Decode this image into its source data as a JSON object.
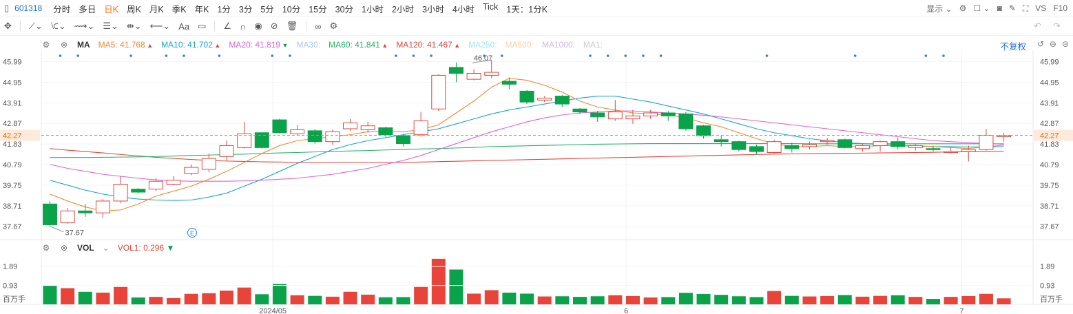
{
  "toolbar_top": {
    "symbol": "601318",
    "timeframes": [
      "分时",
      "多日",
      "日K",
      "周K",
      "月K",
      "季K",
      "年K",
      "1分",
      "3分",
      "5分",
      "10分",
      "15分",
      "30分",
      "1小时",
      "2小时",
      "3小时",
      "4小时",
      "Tick",
      "1天：1分K"
    ],
    "active_timeframe": "日K",
    "display_label": "显示",
    "vs_label": "VS",
    "f10_label": "F10"
  },
  "ma_legend": {
    "name": "MA",
    "items": [
      {
        "label": "MA5:",
        "value": "41.768",
        "color": "#f5872e",
        "arrow": "▲"
      },
      {
        "label": "MA10:",
        "value": "41.702",
        "color": "#1aa3d9",
        "arrow": "▲"
      },
      {
        "label": "MA20:",
        "value": "41.819",
        "color": "#e060e0",
        "arrow": "▼"
      },
      {
        "label": "MA30:",
        "value": "",
        "color": "#a9c7f0",
        "arrow": ""
      },
      {
        "label": "MA60:",
        "value": "41.841",
        "color": "#26b36b",
        "arrow": "▲"
      },
      {
        "label": "MA120:",
        "value": "41.467",
        "color": "#e8443a",
        "arrow": "▲"
      },
      {
        "label": "MA250:",
        "value": "",
        "color": "#9fe6f0",
        "arrow": ""
      },
      {
        "label": "MA500:",
        "value": "",
        "color": "#f6d2a8",
        "arrow": ""
      },
      {
        "label": "MA1000:",
        "value": "",
        "color": "#d3b6ef",
        "arrow": ""
      },
      {
        "label": "MA1:",
        "value": "",
        "color": "#c8c8c8",
        "arrow": ""
      }
    ],
    "adjust_label": "不复权"
  },
  "vol_legend": {
    "name": "VOL",
    "vol1_label": "VOL1:",
    "vol1_value": "0.296",
    "unit_label": "百万手"
  },
  "colors": {
    "up": "#e8443a",
    "down": "#0aa34a",
    "ma5": "#f5872e",
    "ma10": "#1aa3d9",
    "ma20": "#e060e0",
    "ma60": "#26b36b",
    "ma120": "#e8443a",
    "current": "#f5872e",
    "marker": "#2f80ed"
  },
  "chart_data": {
    "type": "candlestick",
    "y_ticks": [
      "45.99",
      "44.95",
      "43.91",
      "42.87",
      "41.83",
      "40.79",
      "39.75",
      "38.71",
      "37.67"
    ],
    "ylim": [
      37.0,
      46.6
    ],
    "current_price": "42.27",
    "high_label": "46.07",
    "low_label": "37.67",
    "x_labels": [
      "2024/05",
      "6",
      "7"
    ],
    "vol_ticks": [
      "1.89",
      "0.93"
    ],
    "vol_ylim": [
      0,
      2.45
    ],
    "candles": [
      {
        "o": 38.8,
        "c": 37.75,
        "h": 38.95,
        "l": 37.67,
        "v": 0.93
      },
      {
        "o": 37.85,
        "c": 38.45,
        "h": 38.6,
        "l": 37.8,
        "v": 0.8
      },
      {
        "o": 38.45,
        "c": 38.35,
        "h": 38.8,
        "l": 38.15,
        "v": 0.62
      },
      {
        "o": 38.35,
        "c": 38.95,
        "h": 39.05,
        "l": 38.1,
        "v": 0.58
      },
      {
        "o": 38.95,
        "c": 39.8,
        "h": 40.2,
        "l": 38.85,
        "v": 0.86
      },
      {
        "o": 39.55,
        "c": 39.4,
        "h": 39.6,
        "l": 39.35,
        "v": 0.34
      },
      {
        "o": 39.55,
        "c": 39.95,
        "h": 40.1,
        "l": 39.45,
        "v": 0.37
      },
      {
        "o": 39.8,
        "c": 40.0,
        "h": 40.2,
        "l": 39.75,
        "v": 0.31
      },
      {
        "o": 40.35,
        "c": 40.65,
        "h": 40.8,
        "l": 40.25,
        "v": 0.52
      },
      {
        "o": 40.55,
        "c": 41.1,
        "h": 41.35,
        "l": 40.4,
        "v": 0.55
      },
      {
        "o": 41.2,
        "c": 41.75,
        "h": 42.0,
        "l": 41.0,
        "v": 0.68
      },
      {
        "o": 41.65,
        "c": 42.35,
        "h": 42.95,
        "l": 41.6,
        "v": 0.83
      },
      {
        "o": 42.4,
        "c": 41.65,
        "h": 42.4,
        "l": 41.6,
        "v": 0.5
      },
      {
        "o": 43.05,
        "c": 42.4,
        "h": 43.1,
        "l": 42.35,
        "v": 1.01
      },
      {
        "o": 42.35,
        "c": 42.55,
        "h": 42.8,
        "l": 42.25,
        "v": 0.45
      },
      {
        "o": 42.5,
        "c": 41.95,
        "h": 42.6,
        "l": 41.85,
        "v": 0.42
      },
      {
        "o": 41.95,
        "c": 42.45,
        "h": 42.55,
        "l": 41.8,
        "v": 0.38
      },
      {
        "o": 42.6,
        "c": 42.9,
        "h": 43.1,
        "l": 42.5,
        "v": 0.62
      },
      {
        "o": 42.55,
        "c": 42.75,
        "h": 42.95,
        "l": 42.4,
        "v": 0.48
      },
      {
        "o": 42.65,
        "c": 42.3,
        "h": 42.7,
        "l": 42.2,
        "v": 0.35
      },
      {
        "o": 42.25,
        "c": 41.85,
        "h": 42.35,
        "l": 41.7,
        "v": 0.36
      },
      {
        "o": 42.3,
        "c": 43.0,
        "h": 43.45,
        "l": 42.2,
        "v": 0.86
      },
      {
        "o": 43.6,
        "c": 45.3,
        "h": 45.35,
        "l": 43.5,
        "v": 2.25
      },
      {
        "o": 45.7,
        "c": 45.4,
        "h": 45.95,
        "l": 44.95,
        "v": 1.72
      },
      {
        "o": 45.1,
        "c": 45.4,
        "h": 45.6,
        "l": 45.05,
        "v": 0.53
      },
      {
        "o": 45.3,
        "c": 45.45,
        "h": 46.07,
        "l": 45.15,
        "v": 0.7
      },
      {
        "o": 45.0,
        "c": 44.85,
        "h": 45.2,
        "l": 44.6,
        "v": 0.58
      },
      {
        "o": 44.5,
        "c": 43.95,
        "h": 44.55,
        "l": 43.85,
        "v": 0.53
      },
      {
        "o": 44.05,
        "c": 44.15,
        "h": 44.25,
        "l": 43.95,
        "v": 0.39
      },
      {
        "o": 44.25,
        "c": 43.85,
        "h": 44.3,
        "l": 43.7,
        "v": 0.4
      },
      {
        "o": 43.6,
        "c": 43.45,
        "h": 43.65,
        "l": 43.35,
        "v": 0.37
      },
      {
        "o": 43.4,
        "c": 43.2,
        "h": 43.5,
        "l": 42.95,
        "v": 0.4
      },
      {
        "o": 43.1,
        "c": 43.45,
        "h": 44.05,
        "l": 43.0,
        "v": 0.45
      },
      {
        "o": 43.1,
        "c": 43.25,
        "h": 43.55,
        "l": 42.85,
        "v": 0.41
      },
      {
        "o": 43.25,
        "c": 43.4,
        "h": 43.55,
        "l": 43.1,
        "v": 0.34
      },
      {
        "o": 43.4,
        "c": 43.25,
        "h": 43.5,
        "l": 43.0,
        "v": 0.36
      },
      {
        "o": 43.35,
        "c": 42.6,
        "h": 43.45,
        "l": 42.5,
        "v": 0.57
      },
      {
        "o": 42.75,
        "c": 42.25,
        "h": 42.8,
        "l": 42.1,
        "v": 0.51
      },
      {
        "o": 42.05,
        "c": 41.95,
        "h": 42.25,
        "l": 41.7,
        "v": 0.47
      },
      {
        "o": 41.95,
        "c": 41.55,
        "h": 42.0,
        "l": 41.45,
        "v": 0.4
      },
      {
        "o": 41.7,
        "c": 41.45,
        "h": 41.8,
        "l": 41.3,
        "v": 0.36
      },
      {
        "o": 41.4,
        "c": 41.95,
        "h": 42.05,
        "l": 41.35,
        "v": 0.66
      },
      {
        "o": 41.75,
        "c": 41.6,
        "h": 41.9,
        "l": 41.4,
        "v": 0.42
      },
      {
        "o": 41.7,
        "c": 41.8,
        "h": 41.95,
        "l": 41.55,
        "v": 0.39
      },
      {
        "o": 41.95,
        "c": 42.0,
        "h": 42.15,
        "l": 41.8,
        "v": 0.41
      },
      {
        "o": 42.05,
        "c": 41.65,
        "h": 42.1,
        "l": 41.6,
        "v": 0.46
      },
      {
        "o": 41.6,
        "c": 41.75,
        "h": 41.85,
        "l": 41.45,
        "v": 0.38
      },
      {
        "o": 41.75,
        "c": 41.95,
        "h": 42.0,
        "l": 41.45,
        "v": 0.42
      },
      {
        "o": 41.95,
        "c": 41.7,
        "h": 42.15,
        "l": 41.55,
        "v": 0.45
      },
      {
        "o": 41.65,
        "c": 41.75,
        "h": 41.85,
        "l": 41.5,
        "v": 0.37
      },
      {
        "o": 41.6,
        "c": 41.55,
        "h": 41.75,
        "l": 41.45,
        "v": 0.27
      },
      {
        "o": 41.4,
        "c": 41.45,
        "h": 41.65,
        "l": 41.35,
        "v": 0.37
      },
      {
        "o": 41.45,
        "c": 41.55,
        "h": 41.75,
        "l": 40.95,
        "v": 0.41
      },
      {
        "o": 41.55,
        "c": 42.27,
        "h": 42.6,
        "l": 41.5,
        "v": 0.52
      },
      {
        "o": 42.2,
        "c": 42.27,
        "h": 42.4,
        "l": 41.95,
        "v": 0.296
      }
    ],
    "ma5": [
      39.3,
      38.95,
      38.65,
      38.45,
      38.5,
      38.8,
      39.2,
      39.45,
      39.7,
      40.05,
      40.45,
      40.9,
      41.35,
      41.75,
      42.0,
      42.1,
      42.2,
      42.3,
      42.45,
      42.5,
      42.45,
      42.55,
      42.8,
      43.4,
      44.0,
      44.7,
      45.15,
      45.05,
      44.8,
      44.45,
      44.0,
      43.7,
      43.55,
      43.4,
      43.35,
      43.3,
      43.15,
      42.9,
      42.7,
      42.4,
      42.1,
      41.85,
      41.7,
      41.7,
      41.75,
      41.7,
      41.7,
      41.75,
      41.75,
      41.75,
      41.7,
      41.65,
      41.6,
      41.7,
      41.77
    ],
    "ma10": [
      40.0,
      39.75,
      39.5,
      39.3,
      39.15,
      39.05,
      39.0,
      38.98,
      39.0,
      39.15,
      39.35,
      39.7,
      40.05,
      40.45,
      40.85,
      41.2,
      41.55,
      41.8,
      42.0,
      42.15,
      42.3,
      42.45,
      42.6,
      42.85,
      43.1,
      43.35,
      43.55,
      43.7,
      43.85,
      44.0,
      44.15,
      44.25,
      44.25,
      44.1,
      43.95,
      43.75,
      43.55,
      43.35,
      43.1,
      42.85,
      42.6,
      42.4,
      42.25,
      42.1,
      42.0,
      41.9,
      41.85,
      41.8,
      41.75,
      41.72,
      41.7,
      41.7,
      41.68,
      41.68,
      41.7
    ],
    "ma20": [
      40.8,
      40.6,
      40.45,
      40.3,
      40.2,
      40.1,
      40.02,
      39.97,
      39.95,
      39.95,
      39.95,
      39.97,
      40.0,
      40.05,
      40.1,
      40.2,
      40.3,
      40.45,
      40.6,
      40.8,
      41.0,
      41.25,
      41.55,
      41.85,
      42.15,
      42.45,
      42.7,
      42.95,
      43.15,
      43.3,
      43.4,
      43.45,
      43.5,
      43.5,
      43.45,
      43.4,
      43.35,
      43.28,
      43.2,
      43.1,
      43.0,
      42.9,
      42.8,
      42.7,
      42.6,
      42.5,
      42.4,
      42.3,
      42.2,
      42.1,
      42.0,
      41.95,
      41.9,
      41.85,
      41.82
    ],
    "ma60": [
      41.15,
      41.15,
      41.15,
      41.16,
      41.17,
      41.18,
      41.2,
      41.22,
      41.25,
      41.27,
      41.3,
      41.32,
      41.35,
      41.38,
      41.4,
      41.43,
      41.45,
      41.48,
      41.5,
      41.53,
      41.55,
      41.58,
      41.6,
      41.63,
      41.66,
      41.7,
      41.72,
      41.74,
      41.76,
      41.78,
      41.8,
      41.82,
      41.83,
      41.84,
      41.85,
      41.85,
      41.85,
      41.85,
      41.85,
      41.85,
      41.85,
      41.85,
      41.85,
      41.84,
      41.84,
      41.84,
      41.84,
      41.84,
      41.84,
      41.84,
      41.84,
      41.84,
      41.84,
      41.84,
      41.84
    ],
    "ma120": [
      41.6,
      41.52,
      41.45,
      41.38,
      41.3,
      41.23,
      41.16,
      41.1,
      41.05,
      41.0,
      40.97,
      40.95,
      40.93,
      40.92,
      40.9,
      40.9,
      40.9,
      40.9,
      40.9,
      40.9,
      40.9,
      40.92,
      40.94,
      40.96,
      40.98,
      41.0,
      41.02,
      41.04,
      41.06,
      41.08,
      41.1,
      41.12,
      41.14,
      41.16,
      41.18,
      41.2,
      41.22,
      41.24,
      41.26,
      41.28,
      41.3,
      41.32,
      41.33,
      41.34,
      41.35,
      41.36,
      41.37,
      41.38,
      41.39,
      41.4,
      41.41,
      41.43,
      41.44,
      41.45,
      41.47
    ]
  }
}
